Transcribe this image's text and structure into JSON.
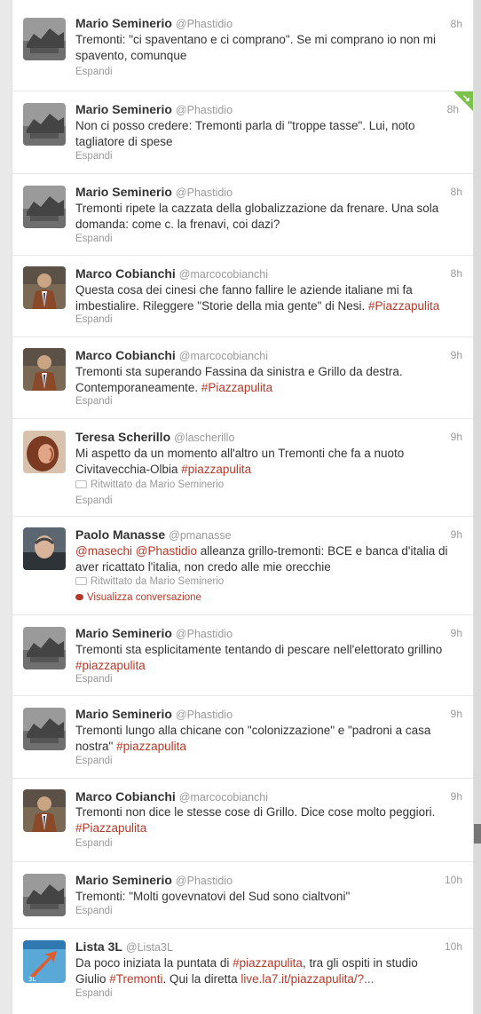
{
  "tweets": [
    {
      "name": "Mario Seminerio",
      "handle": "@Phastidio",
      "time": "8h",
      "text": "Tremonti: \"ci spaventano e ci comprano\". Se mi comprano io non mi spavento, comunque",
      "expand": "Espandi",
      "avatar": "mario-avatar"
    },
    {
      "name": "Mario Seminerio",
      "handle": "@Phastidio",
      "time": "8h",
      "text": "Non ci posso credere: Tremonti parla di \"troppe tasse\". Lui, noto tagliatore di spese",
      "expand": "Espandi",
      "avatar": "mario-avatar"
    },
    {
      "name": "Mario Seminerio",
      "handle": "@Phastidio",
      "time": "8h",
      "text": "Tremonti ripete la cazzata della globalizzazione da frenare. Una sola domanda: come c. la frenavi, coi dazi?",
      "expand": "Espandi",
      "avatar": "mario-avatar"
    },
    {
      "name": "Marco Cobianchi",
      "handle": "@marcocobianchi",
      "time": "8h",
      "text_pre": "Questa cosa dei cinesi che fanno fallire le aziende italiane mi fa imbestialire. Rileggere \"Storie della mia gente\" di Nesi. ",
      "hashtag": "#Piazzapulita",
      "expand": "Espandi",
      "avatar": "marco-avatar"
    },
    {
      "name": "Marco Cobianchi",
      "handle": "@marcocobianchi",
      "time": "9h",
      "text_pre": "Tremonti sta superando Fassina da sinistra e Grillo da destra. Contemporaneamente. ",
      "hashtag": "#Piazzapulita",
      "expand": "Espandi",
      "avatar": "marco-avatar"
    },
    {
      "name": "Teresa Scherillo",
      "handle": "@lascherillo",
      "time": "9h",
      "text_pre": "Mi aspetto da un momento all'altro un Tremonti che fa a nuoto Civitavecchia-Olbia ",
      "hashtag": "#piazzapulita",
      "retweeted": "Ritwittato da Mario Seminerio",
      "expand": "Espandi",
      "avatar": "teresa-avatar"
    },
    {
      "name": "Paolo Manasse",
      "handle": "@pmanasse",
      "time": "9h",
      "mention1": "@masechi",
      "mention2": "@Phastidio",
      "text_post": " alleanza grillo-tremonti: BCE e banca d'italia di aver ricattato l'italia, non credo alle mie orecchie",
      "retweeted": "Ritwittato da Mario Seminerio",
      "conversation": "Visualizza conversazione",
      "avatar": "paolo-avatar"
    },
    {
      "name": "Mario Seminerio",
      "handle": "@Phastidio",
      "time": "9h",
      "text_pre": "Tremonti sta esplicitamente tentando di pescare nell'elettorato grillino ",
      "hashtag": "#piazzapulita",
      "expand": "Espandi",
      "avatar": "mario-avatar"
    },
    {
      "name": "Mario Seminerio",
      "handle": "@Phastidio",
      "time": "9h",
      "text_pre": "Tremonti lungo alla chicane con \"colonizzazione\" e \"padroni a casa nostra\" ",
      "hashtag": "#piazzapulita",
      "expand": "Espandi",
      "avatar": "mario-avatar"
    },
    {
      "name": "Marco Cobianchi",
      "handle": "@marcocobianchi",
      "time": "9h",
      "text_pre": "Tremonti non dice le stesse cose di Grillo. Dice cose molto peggiori. ",
      "hashtag": "#Piazzapulita",
      "expand": "Espandi",
      "avatar": "marco-avatar"
    },
    {
      "name": "Mario Seminerio",
      "handle": "@Phastidio",
      "time": "10h",
      "text": "Tremonti: \"Molti govevnatovi del Sud sono cialtvoni\"",
      "expand": "Espandi",
      "avatar": "mario-avatar"
    },
    {
      "name": "Lista 3L",
      "handle": "@Lista3L",
      "time": "10h",
      "text_pre": "Da poco iniziata la puntata di ",
      "hashtag": "#piazzapulita",
      "text_mid": ", tra gli ospiti in studio Giulio ",
      "hashtag2": "#Tremonti",
      "text_mid2": ". Qui la diretta ",
      "link": "live.la7.it/piazzapulita/?...",
      "expand": "Espandi",
      "avatar": "lista-avatar"
    }
  ],
  "colors": {
    "accent": "#b33a2a",
    "muted": "#999999",
    "text": "#333333",
    "badge": "#7cc24a"
  }
}
